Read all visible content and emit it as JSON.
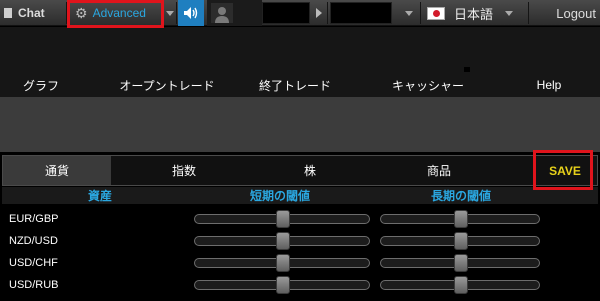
{
  "topbar": {
    "chat_label": "Chat",
    "mode_label": "Advanced",
    "language_label": "日本語",
    "logout_label": "Logout"
  },
  "nav": {
    "items": [
      "グラフ",
      "オープントレード",
      "終了トレード",
      "キャッシャー",
      "Help"
    ]
  },
  "tabs": {
    "items": [
      "通貨",
      "指数",
      "株",
      "商品"
    ],
    "active": "通貨",
    "save_label": "SAVE"
  },
  "table": {
    "headers": [
      "資産",
      "短期の閾値",
      "長期の閾値"
    ],
    "rows": [
      {
        "asset": "EUR/GBP",
        "short_term": 0.5,
        "long_term": 0.5
      },
      {
        "asset": "NZD/USD",
        "short_term": 0.5,
        "long_term": 0.5
      },
      {
        "asset": "USD/CHF",
        "short_term": 0.5,
        "long_term": 0.5
      },
      {
        "asset": "USD/RUB",
        "short_term": 0.5,
        "long_term": 0.5
      }
    ]
  },
  "colors": {
    "accent": "#2aa7e0",
    "save_text": "#e8d21a",
    "highlight": "#e0141c"
  },
  "icons": [
    "gear-icon",
    "speaker-icon",
    "user-icon",
    "play-icon",
    "japan-flag-icon",
    "chevron-down-icon"
  ]
}
